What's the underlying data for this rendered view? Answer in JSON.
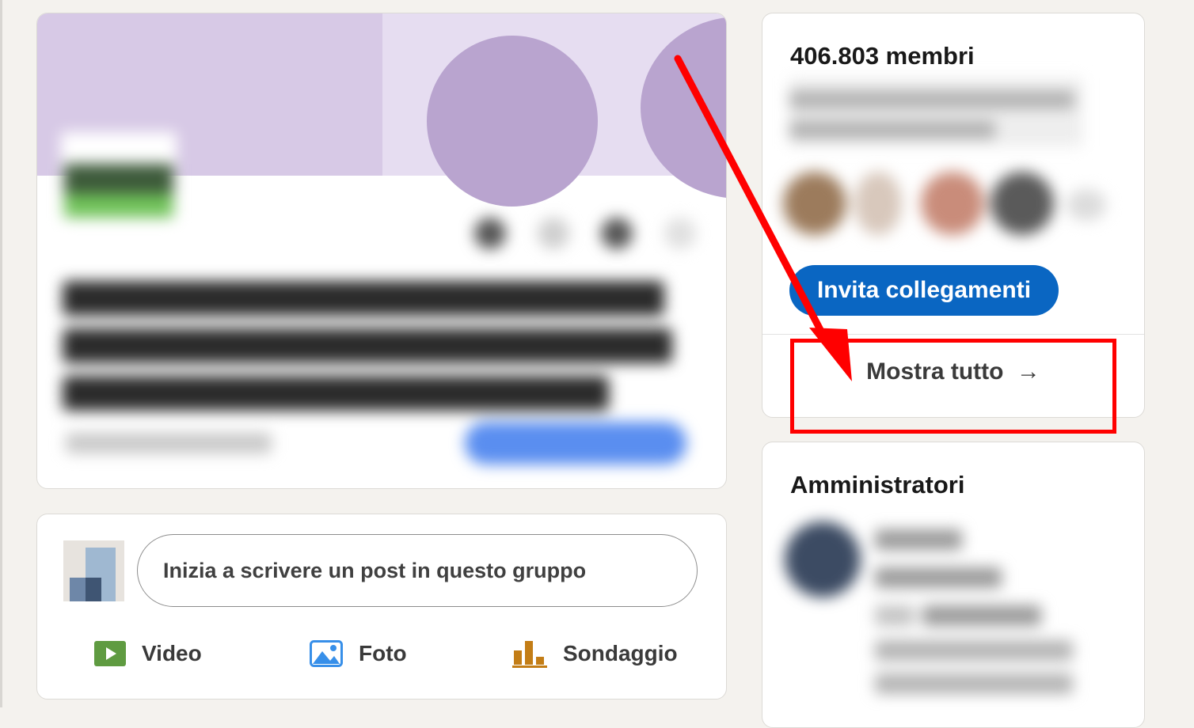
{
  "composer": {
    "placeholder": "Inizia a scrivere un post in questo gruppo",
    "actions": [
      {
        "label": "Video",
        "icon": "video-icon",
        "color": "#5f9b41"
      },
      {
        "label": "Foto",
        "icon": "photo-icon",
        "color": "#378fe9"
      },
      {
        "label": "Sondaggio",
        "icon": "poll-icon",
        "color": "#c37d16"
      }
    ]
  },
  "members": {
    "count_label": "406.803 membri",
    "invite_label": "Invita collegamenti",
    "show_all_label": "Mostra tutto",
    "show_all_arrow": "→"
  },
  "admins": {
    "title": "Amministratori"
  },
  "colors": {
    "primary_button": "#0a66c2",
    "annotation": "#ff0000",
    "page_bg": "#f4f2ee"
  }
}
